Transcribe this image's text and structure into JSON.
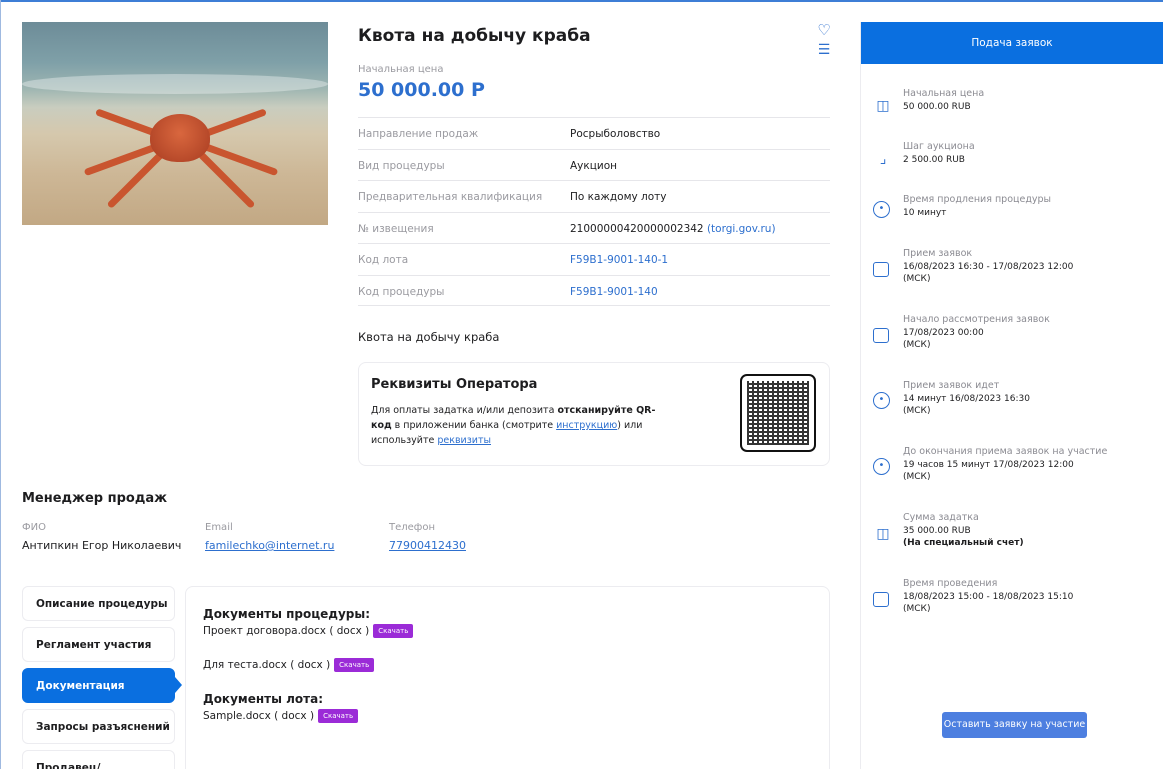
{
  "lot": {
    "title": "Квота на добычу краба",
    "start_price_label": "Начальная цена",
    "start_price_value": "50 000.00 Р",
    "description": "Квота на добычу краба",
    "info": [
      {
        "key": "Направление продаж",
        "value": "Росрыболовство"
      },
      {
        "key": "Вид процедуры",
        "value": "Аукцион"
      },
      {
        "key": "Предварительная квалификация",
        "value": "По каждому лоту"
      },
      {
        "key": "№ извещения",
        "value": "21000000420000002342",
        "extra": "(torgi.gov.ru)"
      },
      {
        "key": "Код лота",
        "value": "F59B1-9001-140-1"
      },
      {
        "key": "Код процедуры",
        "value": "F59B1-9001-140"
      }
    ]
  },
  "icons": {
    "favorite": "heart-icon",
    "layers": "layers-icon"
  },
  "requisites": {
    "title": "Реквизиты Оператора",
    "text_1": "Для оплаты задатка и/или депозита ",
    "text_bold": "отсканируйте QR-код",
    "text_2": " в приложении банка (смотрите ",
    "link_instruction": "инструкцию",
    "text_3": ") или используйте ",
    "link_requisites": "реквизиты"
  },
  "manager": {
    "title": "Менеджер продаж",
    "fio_label": "ФИО",
    "fio_value": "Антипкин Егор Николаевич",
    "email_label": "Email",
    "email_value": "familechko@internet.ru",
    "phone_label": "Телефон",
    "phone_value": "77900412430"
  },
  "tabs": [
    {
      "label": "Описание процедуры"
    },
    {
      "label": "Регламент участия"
    },
    {
      "label": "Документация"
    },
    {
      "label": "Запросы разъяснений"
    },
    {
      "label": "Продавец/Организатор"
    }
  ],
  "docs": {
    "procedure_heading": "Документы процедуры:",
    "procedure_docs": [
      "Проект договора.docx ( docx )",
      "Для теста.docx ( docx )"
    ],
    "lot_heading": "Документы лота:",
    "lot_docs": [
      "Sample.docx ( docx )"
    ],
    "download_label": "Скачать"
  },
  "side": {
    "header": "Подача заявок",
    "items": [
      {
        "icon": "money-icon",
        "label": "Начальная цена",
        "value": "50 000.00 RUB"
      },
      {
        "icon": "stairs-icon",
        "label": "Шаг аукциона",
        "value": "2 500.00 RUB"
      },
      {
        "icon": "clock-icon",
        "label": "Время продления процедуры",
        "value": "10 минут"
      },
      {
        "icon": "calendar-icon",
        "label": "Прием заявок",
        "value": "16/08/2023 16:30  - 17/08/2023 12:00",
        "value2": "(МСК)"
      },
      {
        "icon": "calendar-icon",
        "label": "Начало рассмотрения заявок",
        "value": "17/08/2023 00:00",
        "value2": "(МСК)"
      },
      {
        "icon": "clock-icon",
        "label": "Прием заявок идет",
        "value": "14 минут 16/08/2023 16:30",
        "value2": "(МСК)"
      },
      {
        "icon": "clock-icon",
        "label": "До окончания приема заявок на участие",
        "value": "19 часов 15 минут 17/08/2023 12:00",
        "value2": "(МСК)"
      },
      {
        "icon": "money-icon",
        "label": "Сумма задатка",
        "value": "35 000.00 RUB",
        "value2": "(На специальный счет)"
      },
      {
        "icon": "calendar-icon",
        "label": "Время проведения",
        "value": "18/08/2023 15:00 - 18/08/2023 15:10",
        "value2": "(МСК)"
      }
    ],
    "apply_label": "Оставить заявку на участие"
  },
  "colors": {
    "accent": "#0a6fe0",
    "link": "#2d6fce",
    "download": "#9b2bd7"
  }
}
